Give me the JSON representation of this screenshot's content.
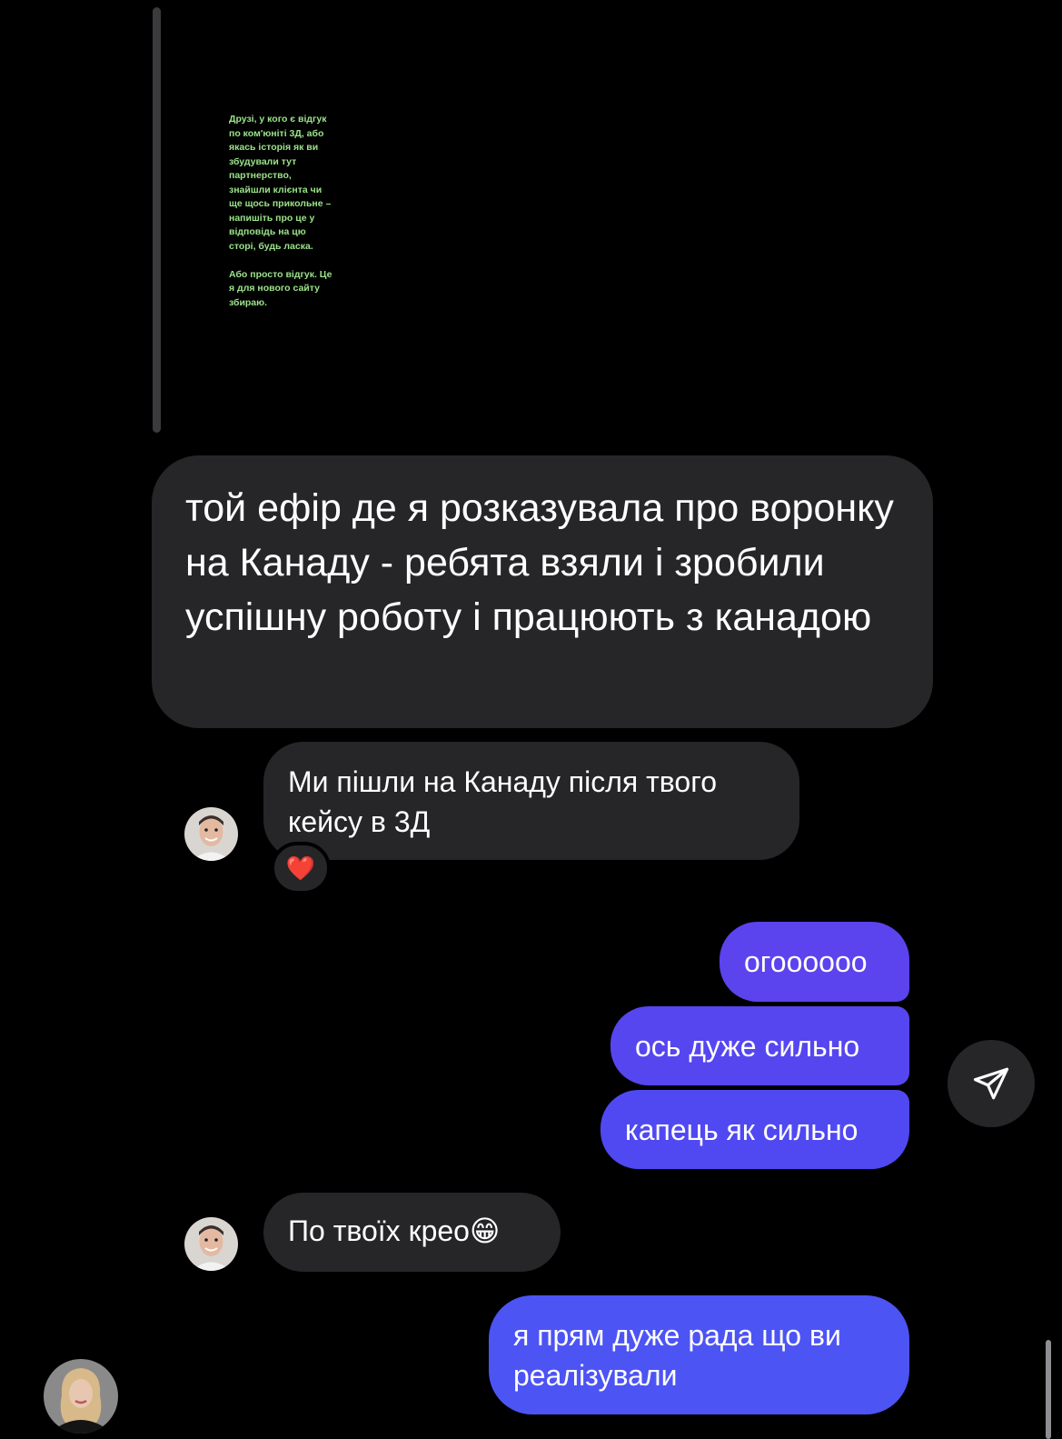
{
  "story_reply": {
    "story_text": "Друзі, у кого є відгук\nпо ком'юніті 3Д, або\nякась історія як ви\nзбудували тут\nпартнерство,\nзнайшли клієнта чи\nще щось прикольне –\nнапишіть про це у\nвідповідь на цю\nсторі, будь ласка.\n\nАбо просто відгук. Це\nя для нового сайту\nзбираю.",
    "reply_text": "той ефір де я розказувала про воронку на Канаду - ребята взяли і зробили успішну роботу і працюють з канадою"
  },
  "messages": [
    {
      "id": "m1",
      "direction": "incoming",
      "text": "Ми пішли на Канаду після твого кейсу в 3Д",
      "reaction": "❤️"
    },
    {
      "id": "m2",
      "direction": "outgoing",
      "text": "огоооооо"
    },
    {
      "id": "m3",
      "direction": "outgoing",
      "text": "ось дуже сильно"
    },
    {
      "id": "m4",
      "direction": "outgoing",
      "text": "капець як сильно"
    },
    {
      "id": "m5",
      "direction": "incoming",
      "text": "По твоїх крео😁"
    },
    {
      "id": "m6",
      "direction": "outgoing",
      "text": "я прям дуже рада що ви реалізували"
    }
  ],
  "icons": {
    "send": "paper-plane-icon",
    "reaction": "heart-icon"
  },
  "colors": {
    "background": "#000000",
    "incoming_bubble": "#262628",
    "outgoing_bubble": "#5646f0",
    "story_text": "#9be38a"
  }
}
